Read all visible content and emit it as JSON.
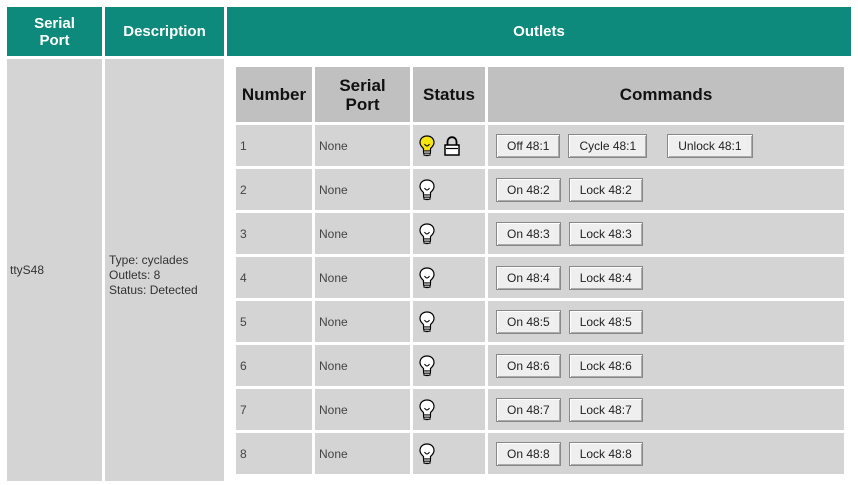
{
  "headers": {
    "serial_port": "Serial\nPort",
    "description": "Description",
    "outlets": "Outlets"
  },
  "port": {
    "name": "ttyS48",
    "type": "Type: cyclades",
    "outlets": "Outlets: 8",
    "status": "Status: Detected"
  },
  "inner_headers": {
    "number": "Number",
    "serial_port": "Serial\nPort",
    "status": "Status",
    "commands": "Commands"
  },
  "rows": [
    {
      "number": "1",
      "serial_port": "None",
      "state": "on",
      "locked": true,
      "buttons": [
        "Off 48:1",
        "Cycle 48:1",
        "Unlock 48:1"
      ]
    },
    {
      "number": "2",
      "serial_port": "None",
      "state": "off",
      "locked": false,
      "buttons": [
        "On 48:2",
        "Lock 48:2"
      ]
    },
    {
      "number": "3",
      "serial_port": "None",
      "state": "off",
      "locked": false,
      "buttons": [
        "On 48:3",
        "Lock 48:3"
      ]
    },
    {
      "number": "4",
      "serial_port": "None",
      "state": "off",
      "locked": false,
      "buttons": [
        "On 48:4",
        "Lock 48:4"
      ]
    },
    {
      "number": "5",
      "serial_port": "None",
      "state": "off",
      "locked": false,
      "buttons": [
        "On 48:5",
        "Lock 48:5"
      ]
    },
    {
      "number": "6",
      "serial_port": "None",
      "state": "off",
      "locked": false,
      "buttons": [
        "On 48:6",
        "Lock 48:6"
      ]
    },
    {
      "number": "7",
      "serial_port": "None",
      "state": "off",
      "locked": false,
      "buttons": [
        "On 48:7",
        "Lock 48:7"
      ]
    },
    {
      "number": "8",
      "serial_port": "None",
      "state": "off",
      "locked": false,
      "buttons": [
        "On 48:8",
        "Lock 48:8"
      ]
    }
  ],
  "icons": {
    "on": "lightbulb-on-icon",
    "off": "lightbulb-off-icon",
    "lock": "padlock-icon"
  },
  "colors": {
    "header_bg": "#0e8a7c",
    "cell_bg": "#d4d4d4",
    "inner_header_bg": "#c0c0c0",
    "bulb_on": "#f6e514"
  }
}
